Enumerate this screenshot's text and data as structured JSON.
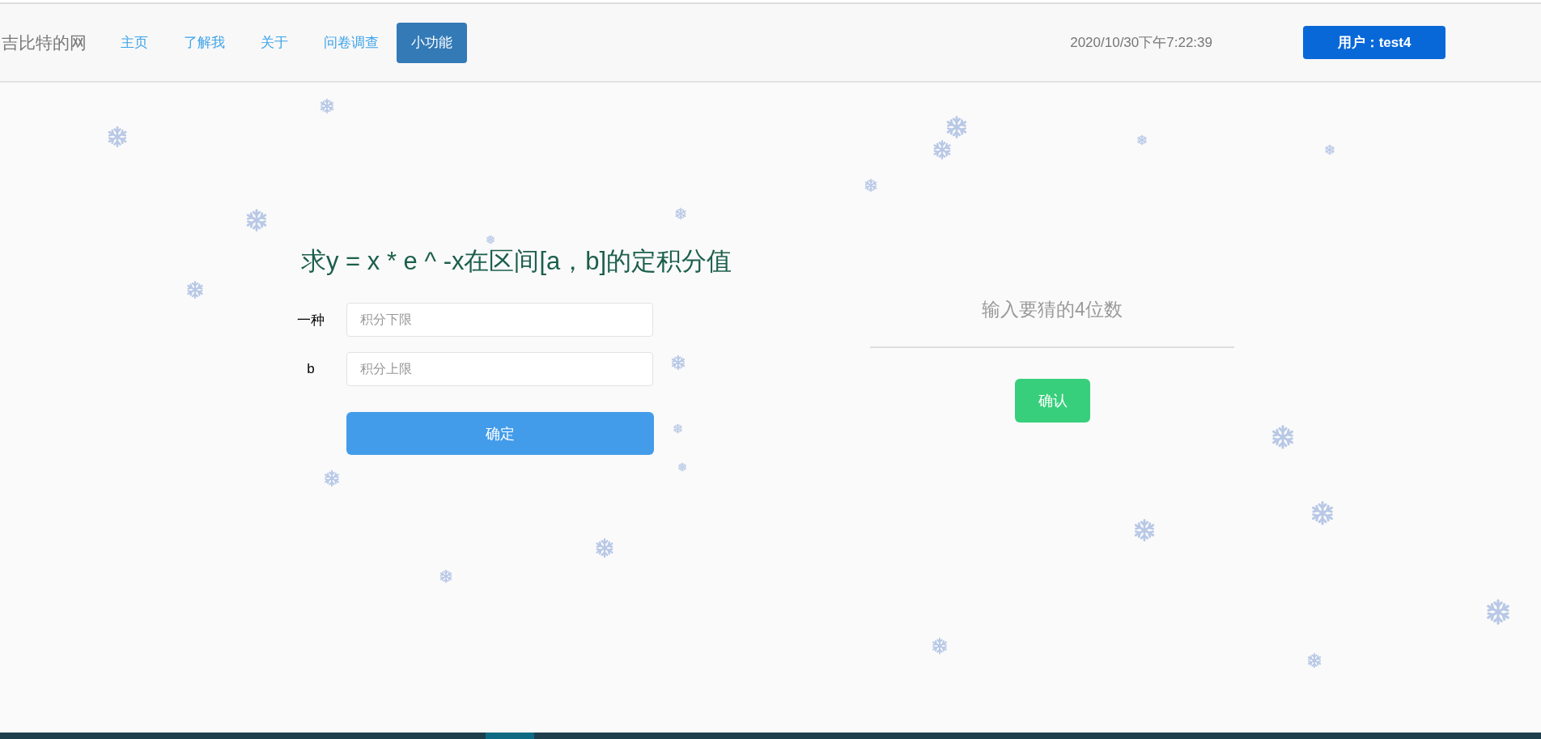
{
  "navbar": {
    "brand": "吉比特的网",
    "links": [
      {
        "label": "主页",
        "selected": false
      },
      {
        "label": "了解我",
        "selected": false
      },
      {
        "label": "关于",
        "selected": false
      },
      {
        "label": "问卷调查",
        "selected": false
      },
      {
        "label": "小功能",
        "selected": true
      }
    ],
    "datetime": "2020/10/30下午7:22:39",
    "user_button": "用户：test4"
  },
  "integral": {
    "title": "求y = x * e ^ -x在区间[a，b]的定积分值",
    "fields": [
      {
        "label": "一种",
        "placeholder": "积分下限"
      },
      {
        "label": "b",
        "placeholder": "积分上限"
      }
    ],
    "button": "确定"
  },
  "guess": {
    "placeholder": "输入要猜的4位数",
    "button": "确认"
  }
}
